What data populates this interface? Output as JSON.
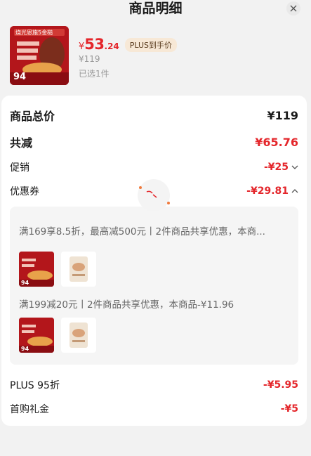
{
  "header": {
    "title": "商品明细"
  },
  "product": {
    "currency": "¥",
    "price_int": "53",
    "price_dec": ".24",
    "plus_tag": "PLUS到手价",
    "original_price": "¥119",
    "selected_qty": "已选1件",
    "thumb_banner": "烧光恩施5金槌",
    "thumb_number": "94"
  },
  "summary": {
    "total_label": "商品总价",
    "total_value": "¥119",
    "discount_label": "共减",
    "discount_value": "¥65.76",
    "promo_label": "促销",
    "promo_value": "-¥25",
    "coupon_label": "优惠券",
    "coupon_value": "-¥29.81"
  },
  "coupons": [
    {
      "text": "满169享8.5折，最高减500元丨2件商品共享优惠，本商..."
    },
    {
      "text": "满199减20元丨2件商品共享优惠，本商品-¥11.96"
    }
  ],
  "extras": {
    "plus_label": "PLUS 95折",
    "plus_value": "-¥5.95",
    "gift_label": "首购礼金",
    "gift_value": "-¥5"
  },
  "colors": {
    "accent": "#e4262b",
    "plus_bg": "#f7e8d6"
  }
}
